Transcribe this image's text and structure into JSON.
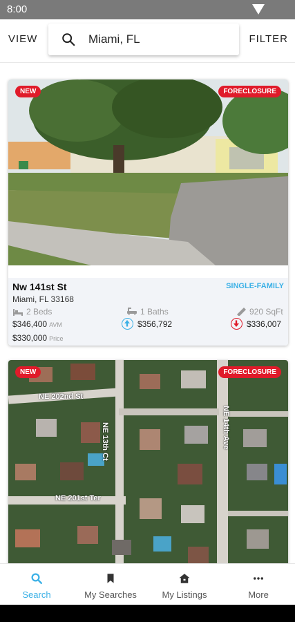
{
  "status": {
    "time": "8:00"
  },
  "topbar": {
    "view_label": "VIEW",
    "filter_label": "FILTER",
    "search_value": "Miami, FL"
  },
  "listings": [
    {
      "badge_new": "NEW",
      "badge_status": "FORECLOSURE",
      "street": "Nw 141st St",
      "city_line": "Miami, FL 33168",
      "property_type": "SINGLE-FAMILY",
      "beds": "2 Beds",
      "baths": "1 Baths",
      "sqft": "920 SqFt",
      "avm_value": "$346,400",
      "avm_label": "AVM",
      "price_value": "$330,000",
      "price_label": "Price",
      "est_up": "$356,792",
      "est_down": "$336,007"
    },
    {
      "badge_new": "NEW",
      "badge_status": "FORECLOSURE",
      "street_labels": [
        "NE 202nd St",
        "NE 201st Ter",
        "NE 13th Ct",
        "NE 14th Ave"
      ]
    }
  ],
  "nav": {
    "items": [
      {
        "label": "Search",
        "icon": "search-icon"
      },
      {
        "label": "My Searches",
        "icon": "bookmark-icon"
      },
      {
        "label": "My Listings",
        "icon": "home-icon"
      },
      {
        "label": "More",
        "icon": "more-dots-icon"
      }
    ]
  },
  "colors": {
    "accent": "#3ab0e6",
    "badge": "#e01b2a",
    "status_bar": "#7a7a7a"
  }
}
